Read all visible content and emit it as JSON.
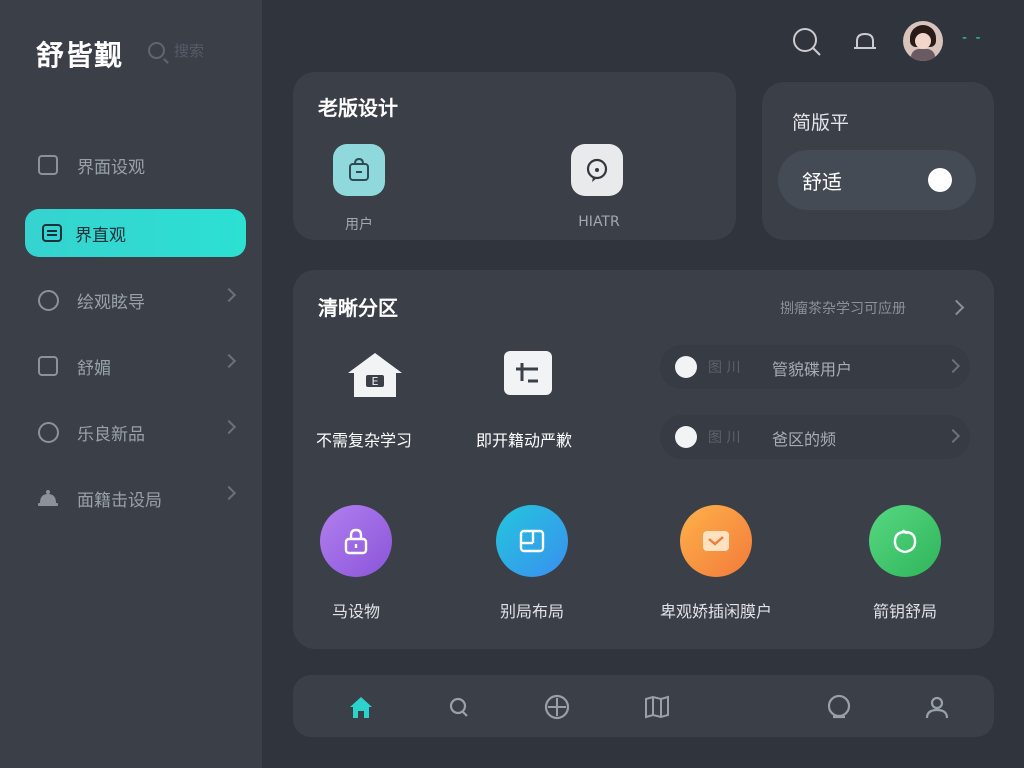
{
  "app": {
    "title": "舒皆觐",
    "title_ghost": "搜索"
  },
  "sidebar": {
    "items": [
      {
        "label": "界面设观",
        "icon": "layout-icon"
      },
      {
        "label": "界直观",
        "icon": "list-icon",
        "active": true
      },
      {
        "label": "绘观眩导",
        "icon": "check-circle-icon"
      },
      {
        "label": "舒媚",
        "icon": "note-icon"
      },
      {
        "label": "乐良新品",
        "icon": "globe-icon"
      },
      {
        "label": "面籍击设局",
        "icon": "robot-icon"
      }
    ]
  },
  "header": {
    "search_icon": "search-icon",
    "notify_icon": "bell-icon",
    "status": "- -"
  },
  "top_card": {
    "title": "老版设计",
    "items": [
      {
        "label": "用户",
        "icon": "bag-icon",
        "color": "#8fd9dc"
      },
      {
        "label": "HIATR",
        "icon": "chat-icon",
        "color": "#e9eaec"
      }
    ]
  },
  "mode_card": {
    "title": "简版平",
    "toggle_label": "舒适"
  },
  "section": {
    "title": "清晰分区",
    "link": "捌瘤茶杂学习可应册",
    "features": [
      {
        "label": "不需复杂学习",
        "icon": "home-cloud-icon"
      },
      {
        "label": "即开籍动严歉",
        "icon": "board-icon"
      }
    ],
    "rows": [
      {
        "prefix": "图 川",
        "label": "管貌碟用户"
      },
      {
        "prefix": "图 川",
        "label": "爸区的频"
      }
    ],
    "actions": [
      {
        "label": "马设物",
        "icon": "lock-icon",
        "color": "#9b6be0"
      },
      {
        "label": "别局布局",
        "icon": "window-icon",
        "color": "#25a9e6"
      },
      {
        "label": "卑观娇插闲膜户",
        "icon": "mail-icon",
        "color": "#f59a3e"
      },
      {
        "label": "箭钥舒局",
        "icon": "leaf-icon",
        "color": "#3fcf6e"
      }
    ]
  },
  "bottom_nav": {
    "items": [
      "home-icon",
      "search-icon",
      "compass-icon",
      "map-icon",
      "message-icon",
      "profile-icon"
    ]
  }
}
